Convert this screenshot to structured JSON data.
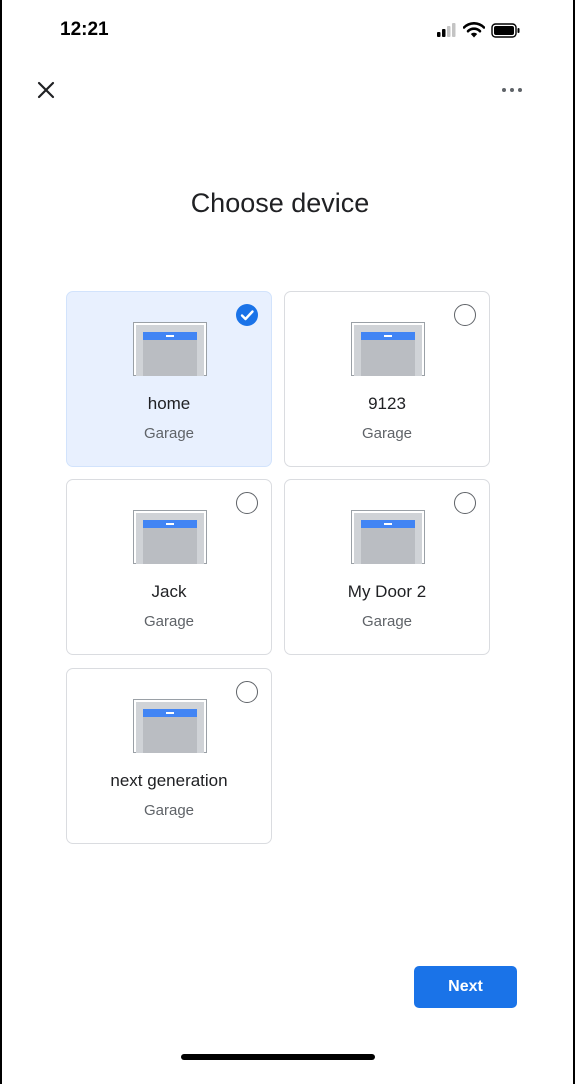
{
  "status_bar": {
    "time": "12:21",
    "icons": [
      "signal-icon",
      "wifi-icon",
      "battery-icon"
    ]
  },
  "topbar": {
    "close_icon": "close-icon",
    "more_icon": "more-options-icon"
  },
  "title": "Choose device",
  "devices": [
    {
      "name": "home",
      "type": "Garage",
      "selected": true
    },
    {
      "name": "9123",
      "type": "Garage",
      "selected": false
    },
    {
      "name": "Jack",
      "type": "Garage",
      "selected": false
    },
    {
      "name": "My Door 2",
      "type": "Garage",
      "selected": false
    },
    {
      "name": "next generation",
      "type": "Garage",
      "selected": false
    }
  ],
  "next_button": {
    "label": "Next"
  },
  "colors": {
    "accent": "#1a73e8",
    "selected_card_bg": "#e8f0fe",
    "card_border": "#dadce0"
  }
}
